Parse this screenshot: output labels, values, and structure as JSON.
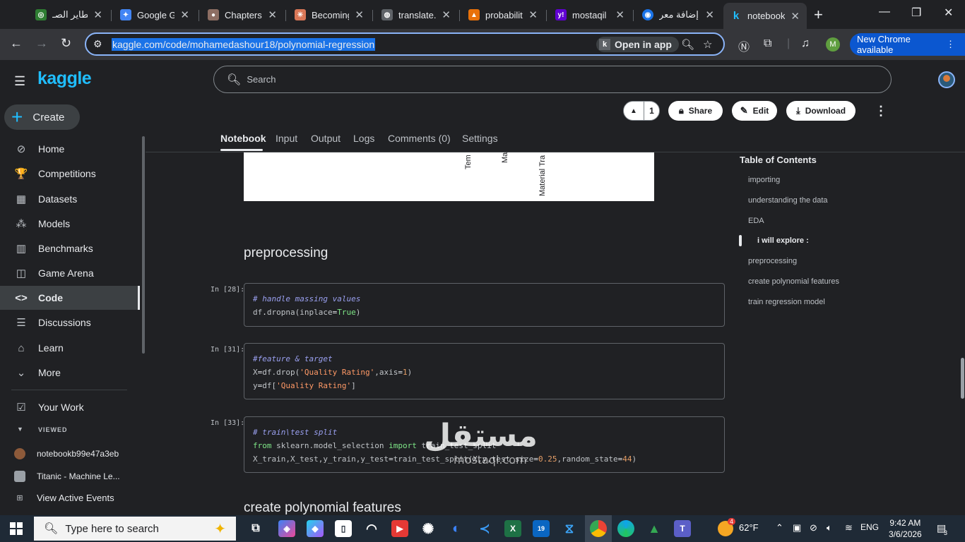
{
  "browser": {
    "tabs": [
      {
        "title": "تطاير الصـ",
        "favicon_color": "#2e7d32",
        "favicon_text": "◎"
      },
      {
        "title": "Google Ge",
        "favicon_color": "#4285f4",
        "favicon_text": "✦"
      },
      {
        "title": "Chapters",
        "favicon_color": "#8d6e63",
        "favicon_text": "●"
      },
      {
        "title": "Becoming",
        "favicon_color": "#d97757",
        "favicon_text": "✳"
      },
      {
        "title": "translate.",
        "favicon_color": "#5f6368",
        "favicon_text": "◍"
      },
      {
        "title": "probabilit",
        "favicon_color": "#e8710a",
        "favicon_text": "▲"
      },
      {
        "title": "mostaqil",
        "favicon_color": "#6001d2",
        "favicon_text": "y!"
      },
      {
        "title": "إضافة معر",
        "favicon_color": "#1a73e8",
        "favicon_text": "◉"
      },
      {
        "title": "notebook",
        "favicon_color": "#20beff",
        "favicon_text": "k"
      }
    ],
    "url": "kaggle.com/code/mohamedashour18/polynomial-regression",
    "open_in_app": "Open in app",
    "profile_initial": "M",
    "new_chrome": "New Chrome available",
    "new_chrome_menu": "⋮"
  },
  "sidebar": {
    "logo": "kaggle",
    "create": "Create",
    "nav": [
      {
        "label": "Home",
        "icon": "⊘"
      },
      {
        "label": "Competitions",
        "icon": "🏆"
      },
      {
        "label": "Datasets",
        "icon": "▦"
      },
      {
        "label": "Models",
        "icon": "⁂"
      },
      {
        "label": "Benchmarks",
        "icon": "▥"
      },
      {
        "label": "Game Arena",
        "icon": "◫"
      },
      {
        "label": "Code",
        "icon": "<>"
      },
      {
        "label": "Discussions",
        "icon": "☰"
      },
      {
        "label": "Learn",
        "icon": "⌂"
      },
      {
        "label": "More",
        "icon": "⌄"
      }
    ],
    "your_work": "Your Work",
    "viewed_label": "VIEWED",
    "viewed": [
      {
        "label": "notebookb99e47a3eb"
      },
      {
        "label": "Titanic - Machine Le..."
      },
      {
        "label": "View Active Events"
      }
    ]
  },
  "header": {
    "search_placeholder": "Search",
    "vote_count": "1",
    "share": "Share",
    "edit": "Edit",
    "download": "Download",
    "tabs": [
      "Notebook",
      "Input",
      "Output",
      "Logs",
      "Comments (0)",
      "Settings"
    ]
  },
  "plot": {
    "tick_labels": [
      "Tem",
      "Ma",
      "Material Tra"
    ]
  },
  "notebook": {
    "heading_preprocessing": "preprocessing",
    "heading_polynomial": "create polynomial features",
    "cells": [
      {
        "prompt": "In [28]:"
      },
      {
        "prompt": "In [31]:"
      },
      {
        "prompt": "In [33]:"
      }
    ]
  },
  "toc": {
    "title": "Table of Contents",
    "items": [
      "importing",
      "understanding the data",
      "EDA",
      "i will explore :",
      "preprocessing",
      "create polynomial features",
      "train regression model"
    ]
  },
  "watermark": {
    "text": "مستقل",
    "sub": "mostaql.com"
  },
  "taskbar": {
    "search_placeholder": "Type here to search",
    "weather": "62°F",
    "language": "ENG",
    "time": "9:42 AM",
    "date": "3/6/2026",
    "notifications": "3",
    "badge_19": "19",
    "badge_4": "4"
  },
  "colors": {
    "kaggle_blue": "#20beff",
    "chrome_accent": "#8ab4f8",
    "new_chrome_bg": "#0b57d0"
  }
}
